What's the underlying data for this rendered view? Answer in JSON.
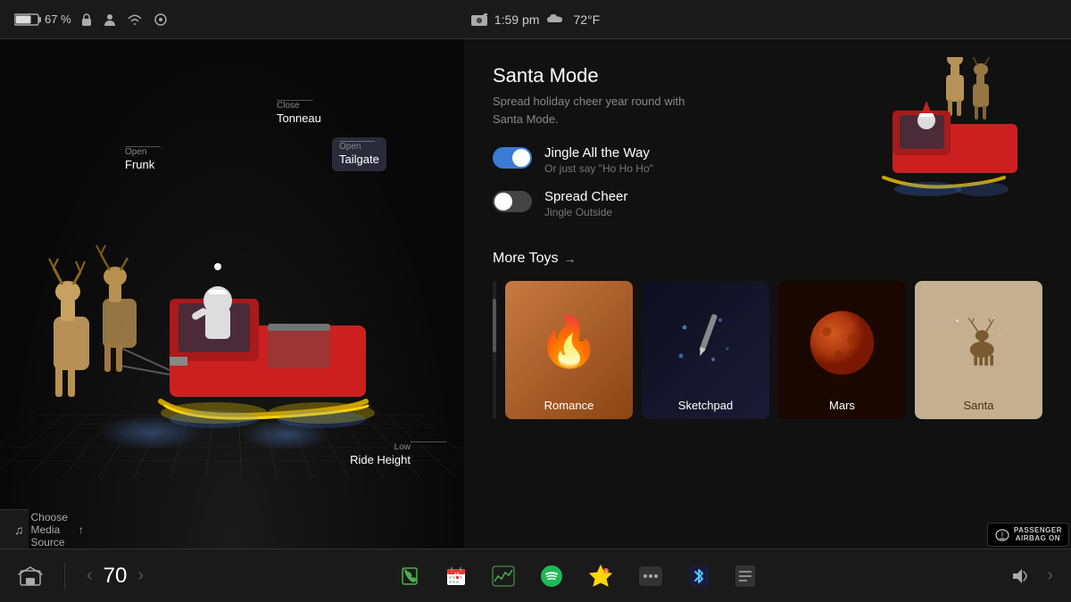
{
  "statusBar": {
    "battery": "67 %",
    "time": "1:59 pm",
    "weather": "72°F",
    "icons": [
      "lock",
      "person",
      "wifi",
      "sync"
    ]
  },
  "leftPanel": {
    "labels": {
      "frunk": {
        "prefix": "Open",
        "main": "Frunk"
      },
      "tonneau": {
        "prefix": "Close",
        "main": "Tonneau"
      },
      "tailgate": {
        "prefix": "Open",
        "main": "Tailgate"
      },
      "rideHeight": {
        "prefix": "Low",
        "main": "Ride Height"
      }
    },
    "mediaBar": {
      "icon": "♫",
      "text": "Choose Media Source",
      "arrow": "↑"
    }
  },
  "rightPanel": {
    "santaMode": {
      "title": "Santa Mode",
      "subtitle": "Spread holiday cheer year round with\nSanta Mode.",
      "toggles": [
        {
          "id": "jingle",
          "label": "Jingle All the Way",
          "sublabel": "Or just say \"Ho Ho Ho\"",
          "on": true
        },
        {
          "id": "spread",
          "label": "Spread Cheer",
          "sublabel": "Jingle Outside",
          "on": false
        }
      ]
    },
    "moreToys": {
      "title": "More Toys",
      "arrow": "→",
      "toys": [
        {
          "id": "romance",
          "label": "Romance",
          "emoji": "🔥"
        },
        {
          "id": "sketchpad",
          "label": "Sketchpad"
        },
        {
          "id": "mars",
          "label": "Mars"
        },
        {
          "id": "santa",
          "label": "Santa"
        }
      ]
    }
  },
  "bottomNav": {
    "speed": "70",
    "arrows": {
      "left": "‹",
      "right": "›"
    },
    "navItems": [
      {
        "id": "home",
        "icon": "⊟"
      },
      {
        "id": "phone",
        "icon": "📞"
      },
      {
        "id": "calendar",
        "icon": "📅"
      },
      {
        "id": "chart",
        "icon": "📈"
      },
      {
        "id": "spotify",
        "icon": "♫"
      },
      {
        "id": "star",
        "icon": "✦"
      },
      {
        "id": "dots",
        "icon": "···"
      },
      {
        "id": "bluetooth",
        "icon": "B"
      },
      {
        "id": "notes",
        "icon": "≡"
      }
    ],
    "volume": "🔊",
    "navRight": "›",
    "airbagLabel": "PASSENGER\nAIRBAG ON"
  }
}
